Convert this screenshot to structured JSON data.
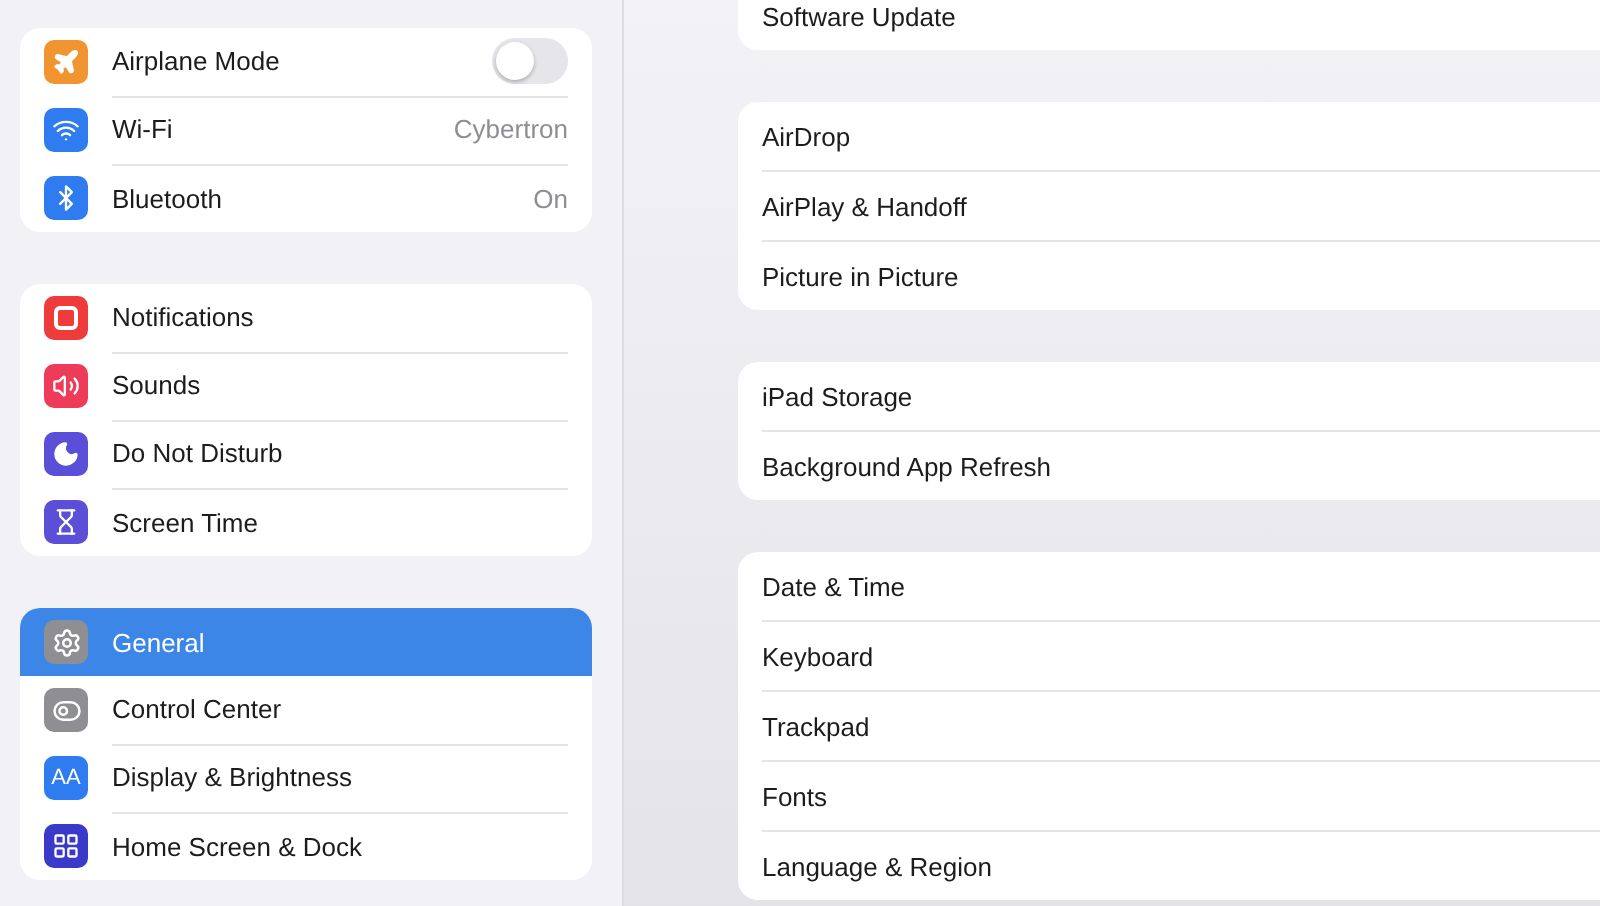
{
  "sidebar": {
    "groups": [
      {
        "items": [
          {
            "kind": "toggle",
            "label": "Airplane Mode",
            "on": false,
            "selected": false
          },
          {
            "kind": "value",
            "label": "Wi-Fi",
            "value": "Cybertron",
            "selected": false
          },
          {
            "kind": "value",
            "label": "Bluetooth",
            "value": "On",
            "selected": false
          }
        ]
      },
      {
        "items": [
          {
            "kind": "link",
            "label": "Notifications",
            "selected": false
          },
          {
            "kind": "link",
            "label": "Sounds",
            "selected": false
          },
          {
            "kind": "link",
            "label": "Do Not Disturb",
            "selected": false
          },
          {
            "kind": "link",
            "label": "Screen Time",
            "selected": false
          }
        ]
      },
      {
        "items": [
          {
            "kind": "link",
            "label": "General",
            "selected": true
          },
          {
            "kind": "link",
            "label": "Control Center",
            "selected": false
          },
          {
            "kind": "link",
            "icon_text": "AA",
            "label": "Display & Brightness",
            "selected": false
          },
          {
            "kind": "link",
            "label": "Home Screen & Dock",
            "selected": false
          }
        ]
      }
    ]
  },
  "detail": {
    "groups": [
      {
        "items": [
          "Software Update"
        ]
      },
      {
        "items": [
          "AirDrop",
          "AirPlay & Handoff",
          "Picture in Picture"
        ]
      },
      {
        "items": [
          "iPad Storage",
          "Background App Refresh"
        ]
      },
      {
        "items": [
          "Date & Time",
          "Keyboard",
          "Trackpad",
          "Fonts",
          "Language & Region"
        ]
      }
    ]
  }
}
